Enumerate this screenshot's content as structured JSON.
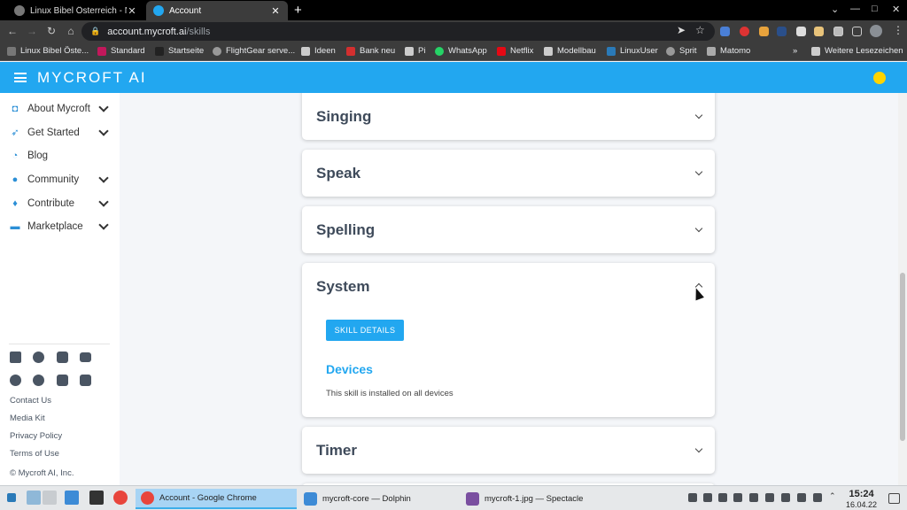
{
  "browser": {
    "tabs": [
      {
        "title": "Linux Bibel Österreich - Neue",
        "active": false
      },
      {
        "title": "Account",
        "active": true
      }
    ],
    "url_host": "account.mycroft.ai",
    "url_path": "/skills",
    "bookmarks": [
      "Linux Bibel Öste...",
      "Standard",
      "Startseite",
      "FlightGear serve...",
      "Ideen",
      "Bank neu",
      "Pi",
      "WhatsApp",
      "Netflix",
      "Modellbau",
      "LinuxUser",
      "Sprit",
      "Matomo"
    ],
    "bookmarks_more": "»",
    "other_bookmarks": "Weitere Lesezeichen"
  },
  "app": {
    "logo": "MYCROFT AI",
    "brand_color": "#22a7f0"
  },
  "sidebar": {
    "items": [
      {
        "label": "About Mycroft",
        "icon": "robot-icon",
        "expandable": true
      },
      {
        "label": "Get Started",
        "icon": "rocket-icon",
        "expandable": true
      },
      {
        "label": "Blog",
        "icon": "rss-icon",
        "expandable": false
      },
      {
        "label": "Community",
        "icon": "users-icon",
        "expandable": true
      },
      {
        "label": "Contribute",
        "icon": "lightbulb-icon",
        "expandable": true
      },
      {
        "label": "Marketplace",
        "icon": "store-icon",
        "expandable": true
      }
    ],
    "social": [
      "twitter-icon",
      "facebook-icon",
      "instagram-icon",
      "youtube-icon",
      "telegram-icon",
      "reddit-icon",
      "linkedin-icon",
      "mastodon-icon"
    ],
    "footer_links": [
      "Contact Us",
      "Media Kit",
      "Privacy Policy",
      "Terms of Use"
    ],
    "copyright": "© Mycroft AI, Inc."
  },
  "skills": {
    "cards": [
      {
        "name": "Singing",
        "expanded": false
      },
      {
        "name": "Speak",
        "expanded": false
      },
      {
        "name": "Spelling",
        "expanded": false
      },
      {
        "name": "System",
        "expanded": true
      },
      {
        "name": "Timer",
        "expanded": false
      }
    ],
    "details_button": "SKILL DETAILS",
    "devices_heading": "Devices",
    "devices_text": "This skill is installed on all devices"
  },
  "taskbar": {
    "tasks": [
      {
        "label": "Account - Google Chrome",
        "active": true
      },
      {
        "label": "mycroft-core — Dolphin",
        "active": false
      },
      {
        "label": "mycroft-1.jpg — Spectacle",
        "active": false
      }
    ],
    "time": "15:24",
    "date": "16.04.22"
  }
}
